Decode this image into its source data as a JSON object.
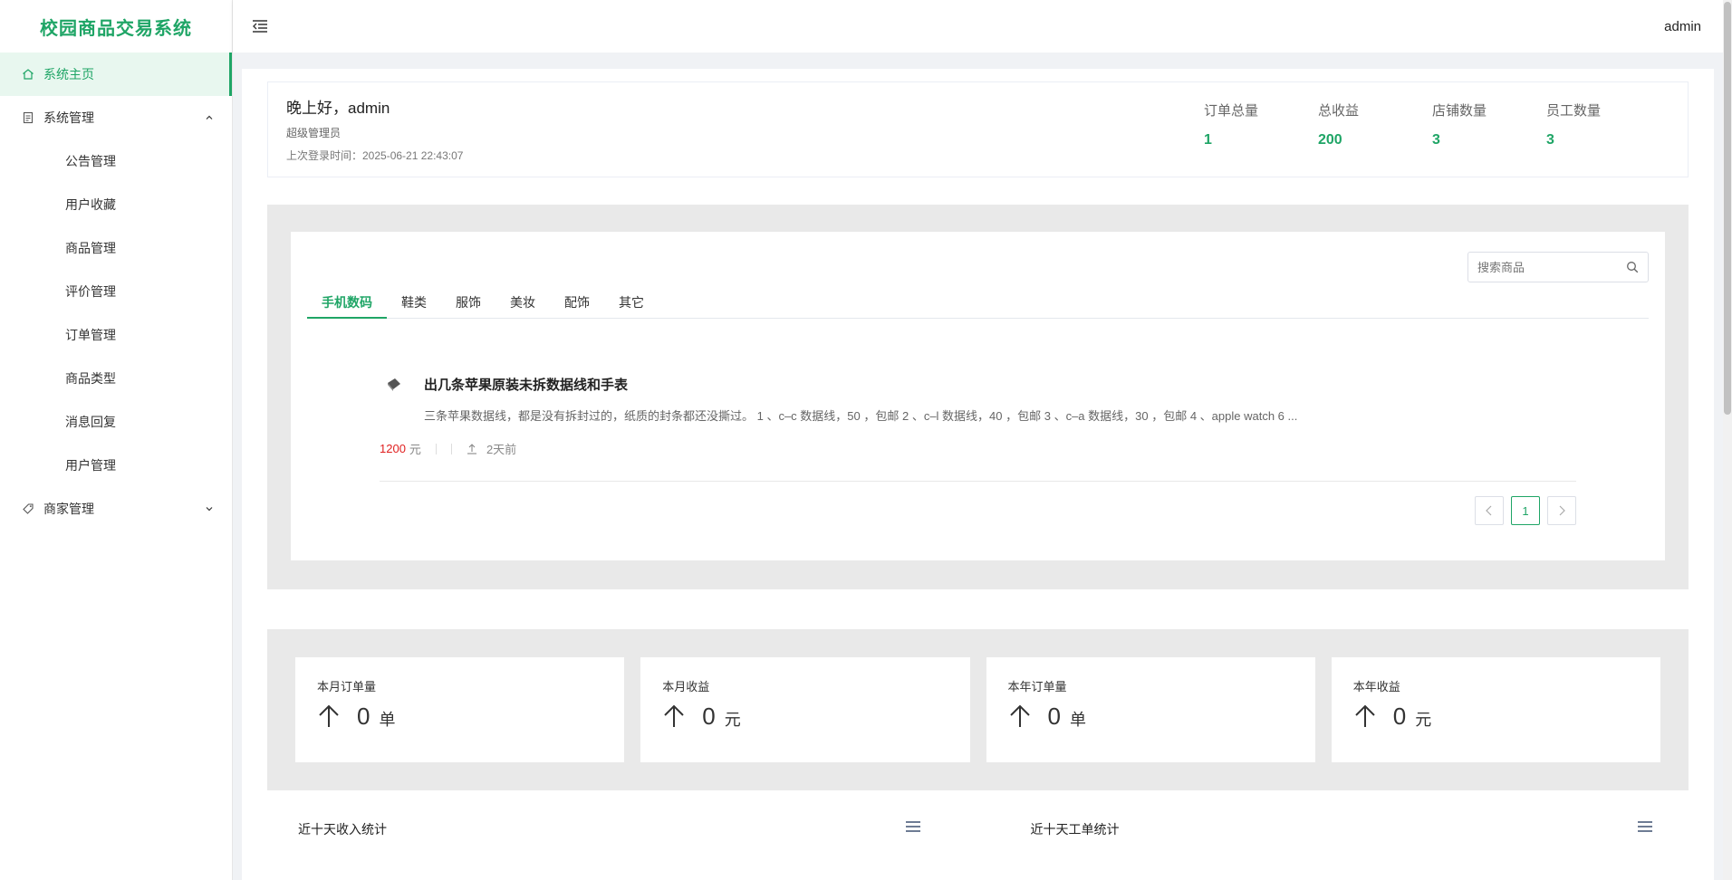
{
  "app": {
    "title": "校园商品交易系统"
  },
  "header": {
    "user": "admin"
  },
  "sidebar": {
    "home": "系统主页",
    "system": {
      "label": "系统管理",
      "items": [
        "公告管理",
        "用户收藏",
        "商品管理",
        "评价管理",
        "订单管理",
        "商品类型",
        "消息回复",
        "用户管理"
      ]
    },
    "merchant": {
      "label": "商家管理"
    }
  },
  "welcome": {
    "greeting": "晚上好，admin",
    "role": "超级管理员",
    "last_login": "上次登录时间：2025-06-21 22:43:07"
  },
  "stats": [
    {
      "label": "订单总量",
      "value": "1"
    },
    {
      "label": "总收益",
      "value": "200"
    },
    {
      "label": "店铺数量",
      "value": "3"
    },
    {
      "label": "员工数量",
      "value": "3"
    }
  ],
  "goods": {
    "search_placeholder": "搜索商品",
    "tabs": [
      "手机数码",
      "鞋类",
      "服饰",
      "美妆",
      "配饰",
      "其它"
    ],
    "active_tab": "手机数码",
    "product": {
      "title": "出几条苹果原装未拆数据线和手表",
      "description": "三条苹果数据线，都是没有拆封过的，纸质的封条都还没撕过。 1 、c–c 数据线，50 ，包邮 2 、c–l 数据线，40 ，包邮 3 、c–a 数据线，30 ，包邮 4 、apple watch 6 ...",
      "price": "1200",
      "unit": "元",
      "time": "2天前"
    },
    "pager": {
      "current": "1"
    }
  },
  "kpis": [
    {
      "label": "本月订单量",
      "value": "0",
      "unit": "单"
    },
    {
      "label": "本月收益",
      "value": "0",
      "unit": "元"
    },
    {
      "label": "本年订单量",
      "value": "0",
      "unit": "单"
    },
    {
      "label": "本年收益",
      "value": "0",
      "unit": "元"
    }
  ],
  "charts": [
    {
      "title": "近十天收入统计"
    },
    {
      "title": "近十天工单统计"
    }
  ],
  "colors": {
    "accent": "#1fa566",
    "price": "#e02020"
  }
}
